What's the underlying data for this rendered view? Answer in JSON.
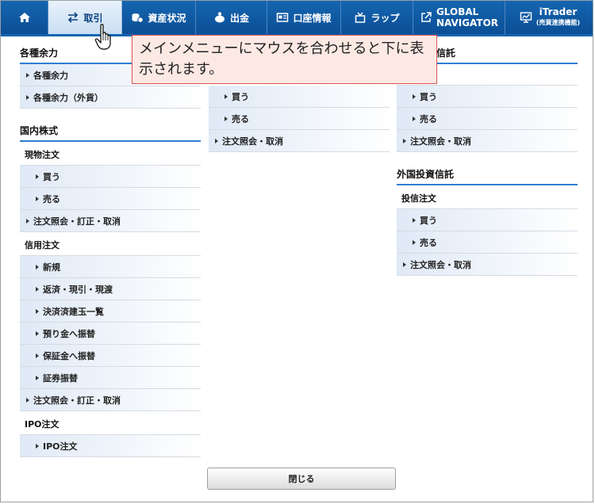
{
  "nav": {
    "items": [
      {
        "label": "",
        "icon": "home-icon"
      },
      {
        "label": "取引",
        "icon": "exchange-icon"
      },
      {
        "label": "資産状況",
        "icon": "coins-icon"
      },
      {
        "label": "出金",
        "icon": "piggy-icon"
      },
      {
        "label": "口座情報",
        "icon": "card-icon"
      },
      {
        "label": "ラップ",
        "icon": "gift-icon"
      },
      {
        "label": "GLOBAL",
        "label2": "NAVIGATOR",
        "icon": "external-link-icon"
      },
      {
        "label": "iTrader",
        "label2": "(売買連携機能)",
        "icon": "chart-monitor-icon"
      }
    ]
  },
  "callout": {
    "text": "メインメニューにマウスを合わせると下に表示されます。"
  },
  "col1": {
    "section1": {
      "title": "各種余力",
      "items": [
        "各種余力",
        "各種余力（外貨）"
      ]
    },
    "section2": {
      "title": "国内株式",
      "genbutsu": {
        "title": "現物注文",
        "items": [
          "買う",
          "売る"
        ],
        "inquiry": "注文照会・訂正・取消"
      },
      "shinyo": {
        "title": "信用注文",
        "items": [
          "新規",
          "返済・現引・現渡",
          "決済済建玉一覧",
          "預り金へ振替",
          "保証金へ振替",
          "証券振替"
        ],
        "inquiry": "注文照会・訂正・取消"
      },
      "ipo": {
        "title": "IPO注文",
        "items": [
          "IPO注文"
        ]
      }
    }
  },
  "col2": {
    "items": [
      "買う",
      "売る"
    ],
    "inquiry": "注文照会・取消"
  },
  "col3": {
    "section1": {
      "title_partial": "信託",
      "items": [
        "買う",
        "売る"
      ],
      "inquiry": "注文照会・取消"
    },
    "section2": {
      "title": "外国投資信託",
      "sub": "投信注文",
      "items": [
        "買う",
        "売る"
      ],
      "inquiry": "注文照会・取消"
    }
  },
  "close_label": "閉じる",
  "colors": {
    "nav": "#0b4f96",
    "accent": "#2f7fd0",
    "callout_border": "#d9534f",
    "callout_bg": "#fde9e4"
  }
}
